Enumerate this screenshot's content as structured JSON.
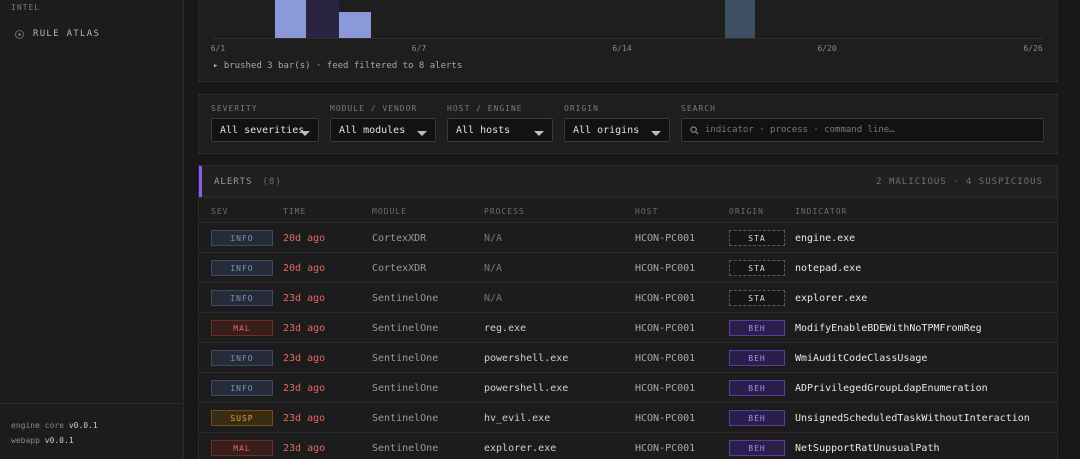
{
  "sidebar": {
    "section_label": "INTEL",
    "items": [
      {
        "label": "RULE ATLAS",
        "icon": "target-icon"
      }
    ],
    "footer": {
      "engine_label": "engine core",
      "engine_version": "v0.0.1",
      "webapp_label": "webapp",
      "webapp_version": "v0.0.1"
    }
  },
  "timeline": {
    "ticks": [
      "6/1",
      "6/7",
      "6/14",
      "6/20",
      "6/26"
    ],
    "brush_info": "▸ brushed 3 bar(s) · feed filtered to 8 alerts",
    "colors": {
      "selected": "#8c99d8",
      "dark": "#2a2342",
      "other": "#3e4f62"
    }
  },
  "filters": {
    "severity": {
      "label": "SEVERITY",
      "value": "All severities"
    },
    "module": {
      "label": "MODULE / VENDOR",
      "value": "All modules"
    },
    "host": {
      "label": "HOST / ENGINE",
      "value": "All hosts"
    },
    "origin": {
      "label": "ORIGIN",
      "value": "All origins"
    },
    "search": {
      "label": "SEARCH",
      "placeholder": "indicator · process · command line…"
    }
  },
  "alerts": {
    "title": "ALERTS",
    "count": "(8)",
    "summary": "2 MALICIOUS · 4 SUSPICIOUS",
    "columns": {
      "sev": "SEV",
      "time": "TIME",
      "module": "MODULE",
      "process": "PROCESS",
      "host": "HOST",
      "origin": "ORIGIN",
      "indicator": "INDICATOR"
    },
    "rows": [
      {
        "sev": "INFO",
        "time": "20d ago",
        "module": "CortexXDR",
        "process": "N/A",
        "host": "HCON-PC001",
        "origin": "STA",
        "indicator": "engine.exe"
      },
      {
        "sev": "INFO",
        "time": "20d ago",
        "module": "CortexXDR",
        "process": "N/A",
        "host": "HCON-PC001",
        "origin": "STA",
        "indicator": "notepad.exe"
      },
      {
        "sev": "INFO",
        "time": "23d ago",
        "module": "SentinelOne",
        "process": "N/A",
        "host": "HCON-PC001",
        "origin": "STA",
        "indicator": "explorer.exe"
      },
      {
        "sev": "MAL",
        "time": "23d ago",
        "module": "SentinelOne",
        "process": "reg.exe",
        "host": "HCON-PC001",
        "origin": "BEH",
        "indicator": "ModifyEnableBDEWithNoTPMFromReg"
      },
      {
        "sev": "INFO",
        "time": "23d ago",
        "module": "SentinelOne",
        "process": "powershell.exe",
        "host": "HCON-PC001",
        "origin": "BEH",
        "indicator": "WmiAuditCodeClassUsage"
      },
      {
        "sev": "INFO",
        "time": "23d ago",
        "module": "SentinelOne",
        "process": "powershell.exe",
        "host": "HCON-PC001",
        "origin": "BEH",
        "indicator": "ADPrivilegedGroupLdapEnumeration"
      },
      {
        "sev": "SUSP",
        "time": "23d ago",
        "module": "SentinelOne",
        "process": "hv_evil.exe",
        "host": "HCON-PC001",
        "origin": "BEH",
        "indicator": "UnsignedScheduledTaskWithoutInteraction"
      },
      {
        "sev": "MAL",
        "time": "23d ago",
        "module": "SentinelOne",
        "process": "explorer.exe",
        "host": "HCON-PC001",
        "origin": "BEH",
        "indicator": "NetSupportRatUnusualPath"
      }
    ]
  }
}
